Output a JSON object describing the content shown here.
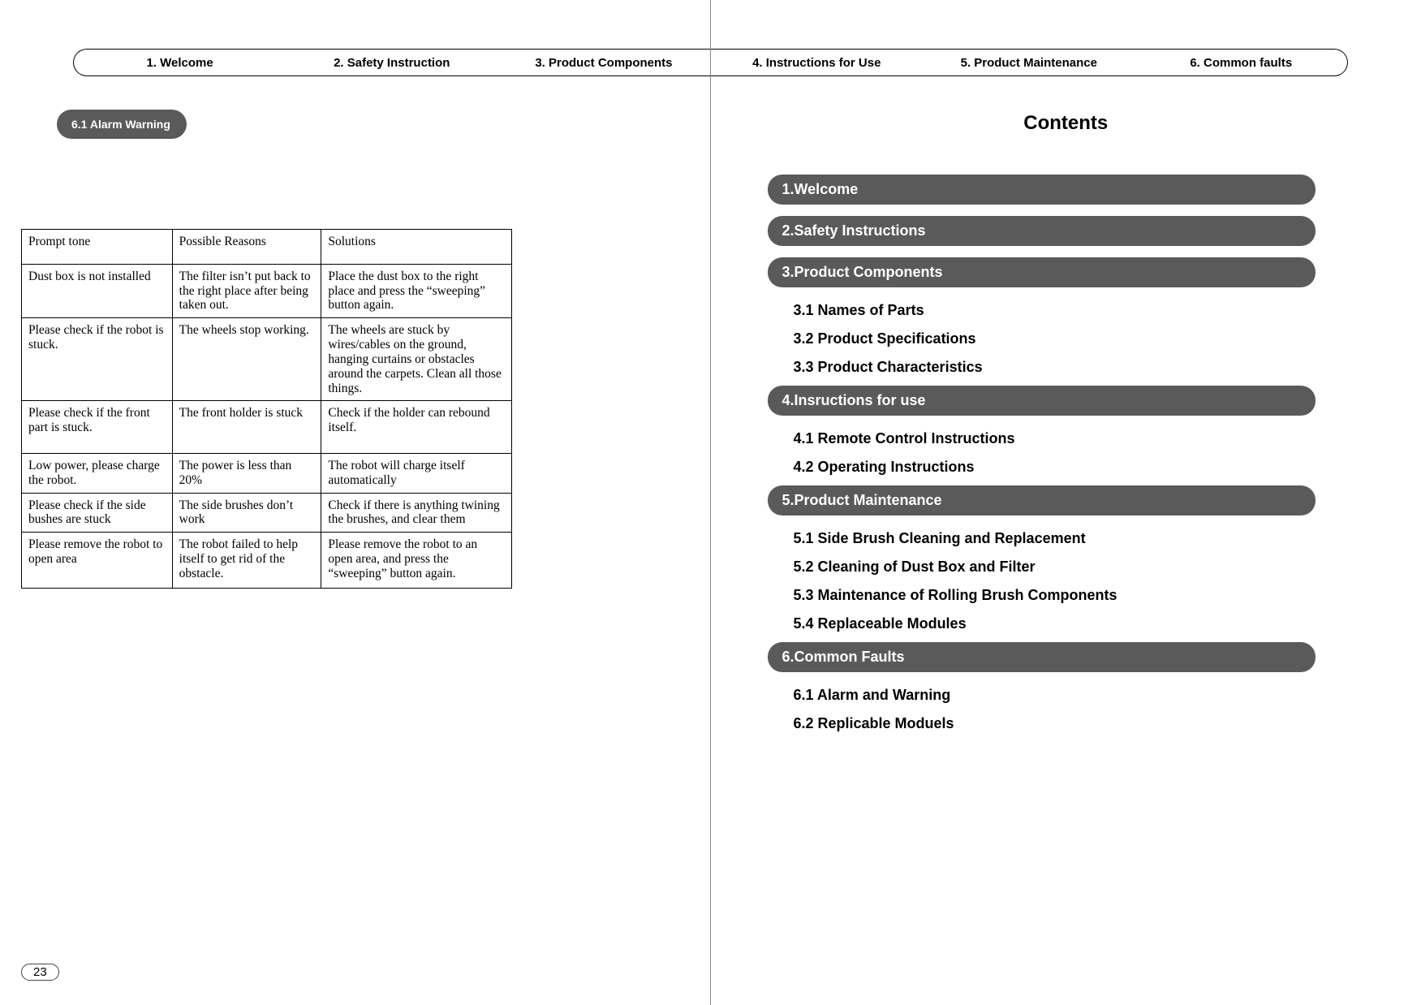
{
  "topbar_left": [
    "1. Welcome",
    "2. Safety Instruction",
    "3. Product Components"
  ],
  "topbar_right": [
    "4. Instructions for Use",
    "5. Product Maintenance",
    "6. Common faults"
  ],
  "left": {
    "badge": "6.1 Alarm Warning",
    "table": {
      "headers": [
        "Prompt tone",
        "Possible Reasons",
        "Solutions"
      ],
      "rows": [
        [
          "Dust box is not installed",
          "The filter isn’t put back to the right place after being taken out.",
          "Place the dust box to the right place and press the “sweeping” button again."
        ],
        [
          "Please check if the robot is stuck.",
          "The wheels stop working.",
          "The wheels are stuck by wires/cables on the ground, hanging curtains or obstacles around the carpets. Clean all those things."
        ],
        [
          "Please check if the front part is stuck.",
          "The front holder is stuck",
          "Check if the holder can rebound itself."
        ],
        [
          "Low power, please charge the robot.",
          "The power is less than 20%",
          "The robot will charge itself automatically"
        ],
        [
          "Please check if the side bushes are stuck",
          "The side brushes don’t work",
          "Check if there is anything twining the brushes, and clear them"
        ],
        [
          "Please remove the robot to open area",
          "The robot failed to help itself to get rid of the obstacle.",
          "Please remove the robot to an open area, and press the “sweeping” button again."
        ]
      ]
    },
    "page_number": "23"
  },
  "right": {
    "title": "Contents",
    "toc": [
      {
        "pill": "1.Welcome",
        "subs": []
      },
      {
        "pill": "2.Safety Instructions",
        "subs": []
      },
      {
        "pill": "3.Product Components",
        "subs": [
          "3.1 Names of Parts",
          "3.2 Product Specifications",
          "3.3 Product Characteristics"
        ]
      },
      {
        "pill": "4.Insructions for use",
        "subs": [
          "4.1 Remote Control Instructions",
          "4.2 Operating Instructions"
        ]
      },
      {
        "pill": "5.Product Maintenance",
        "subs": [
          "5.1 Side Brush Cleaning and Replacement",
          "5.2 Cleaning of Dust Box and Filter",
          "5.3 Maintenance of Rolling Brush Components",
          "5.4 Replaceable Modules"
        ]
      },
      {
        "pill": "6.Common Faults",
        "subs": [
          "6.1 Alarm and Warning",
          "6.2 Replicable Moduels"
        ]
      }
    ]
  }
}
